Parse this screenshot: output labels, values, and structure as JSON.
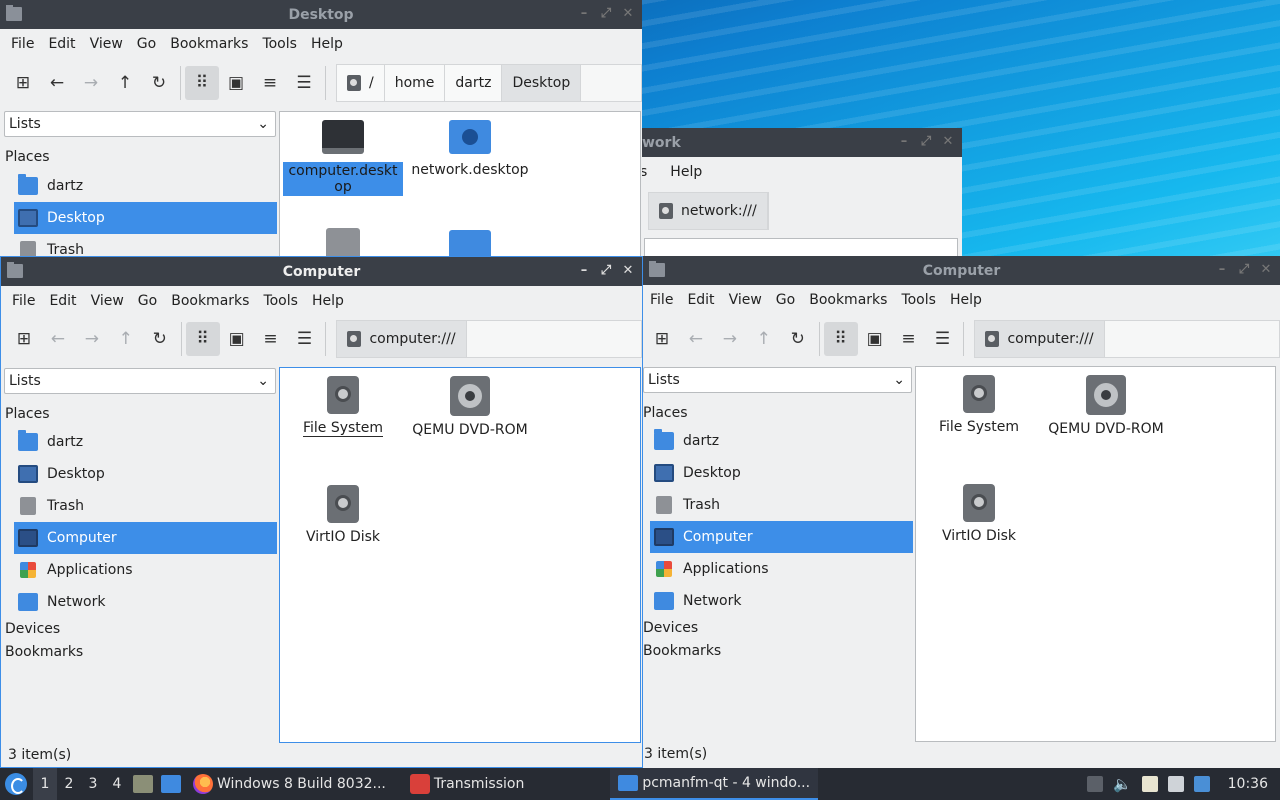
{
  "desktop_window": {
    "title": "Desktop",
    "menu": [
      "File",
      "Edit",
      "View",
      "Go",
      "Bookmarks",
      "Tools",
      "Help"
    ],
    "path": [
      "/",
      "home",
      "dartz",
      "Desktop"
    ],
    "side_pane_mode": "Lists",
    "places_header": "Places",
    "places": [
      "dartz",
      "Desktop",
      "Trash"
    ],
    "files": [
      "computer.desktop",
      "network.desktop"
    ]
  },
  "network_window": {
    "title_fragment": "work",
    "menu_fragment": [
      "s",
      "Help"
    ],
    "path": "network:///"
  },
  "computer_window_left": {
    "title": "Computer",
    "menu": [
      "File",
      "Edit",
      "View",
      "Go",
      "Bookmarks",
      "Tools",
      "Help"
    ],
    "path": "computer:///",
    "side_pane_mode": "Lists",
    "places_header": "Places",
    "places": [
      "dartz",
      "Desktop",
      "Trash",
      "Computer",
      "Applications",
      "Network"
    ],
    "devices_header": "Devices",
    "bookmarks_header": "Bookmarks",
    "files": [
      "File System",
      "QEMU DVD-ROM",
      "VirtIO Disk"
    ],
    "status": "3 item(s)"
  },
  "computer_window_right": {
    "title": "Computer",
    "menu": [
      "File",
      "Edit",
      "View",
      "Go",
      "Bookmarks",
      "Tools",
      "Help"
    ],
    "path": "computer:///",
    "side_pane_mode": "Lists",
    "places_header": "Places",
    "places": [
      "dartz",
      "Desktop",
      "Trash",
      "Computer",
      "Applications",
      "Network"
    ],
    "devices_header": "Devices",
    "bookmarks_header": "Bookmarks",
    "files": [
      "File System",
      "QEMU DVD-ROM",
      "VirtIO Disk"
    ],
    "status": "3 item(s)"
  },
  "taskbar": {
    "workspaces": [
      "1",
      "2",
      "3",
      "4"
    ],
    "tasks": [
      "Windows 8 Build 8032...",
      "Transmission",
      "pcmanfm-qt - 4 windo..."
    ],
    "clock": "10:36"
  }
}
